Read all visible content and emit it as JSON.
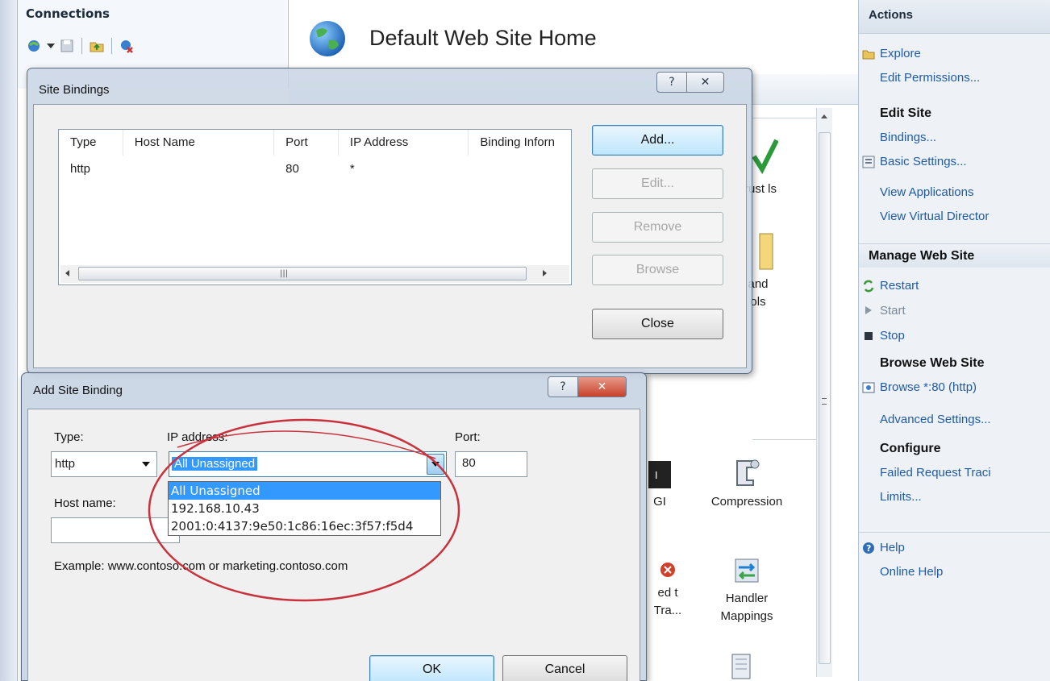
{
  "connections": {
    "title": "Connections"
  },
  "content": {
    "page_title": "Default Web Site Home",
    "features": [
      {
        "label": "rust ls"
      },
      {
        "label": "and ols"
      },
      {
        "label": "GI"
      },
      {
        "label": "Compression"
      },
      {
        "label": "ed t Tra..."
      },
      {
        "label": "Handler Mappings"
      }
    ]
  },
  "actions": {
    "title": "Actions",
    "explore": "Explore",
    "edit_permissions": "Edit Permissions...",
    "edit_site_head": "Edit Site",
    "bindings": "Bindings...",
    "basic_settings": "Basic Settings...",
    "view_applications": "View Applications",
    "view_virtual_directories": "View Virtual Director",
    "manage_head": "Manage Web Site",
    "restart": "Restart",
    "start": "Start",
    "stop": "Stop",
    "browse_head": "Browse Web Site",
    "browse_80": "Browse *:80 (http)",
    "advanced_settings": "Advanced Settings...",
    "configure_head": "Configure",
    "failed_request": "Failed Request Traci",
    "limits": "Limits...",
    "help": "Help",
    "online_help": "Online Help"
  },
  "site_bindings": {
    "title": "Site Bindings",
    "help_glyph": "?",
    "close_glyph": "✕",
    "columns": [
      "Type",
      "Host Name",
      "Port",
      "IP Address",
      "Binding Inforn"
    ],
    "rows": [
      {
        "type": "http",
        "host": "",
        "port": "80",
        "ip": "*",
        "info": ""
      }
    ],
    "buttons": {
      "add": "Add...",
      "edit": "Edit...",
      "remove": "Remove",
      "browse": "Browse",
      "close": "Close"
    }
  },
  "add_binding": {
    "title": "Add Site Binding",
    "type_label": "Type:",
    "type_value": "http",
    "ip_label": "IP address:",
    "ip_value": "All Unassigned",
    "port_label": "Port:",
    "port_value": "80",
    "host_label": "Host name:",
    "host_value": "",
    "example": "Example: www.contoso.com or marketing.contoso.com",
    "ip_options": [
      "All Unassigned",
      "192.168.10.43",
      "2001:0:4137:9e50:1c86:16ec:3f57:f5d4"
    ],
    "ok": "OK",
    "cancel": "Cancel"
  },
  "colors": {
    "link": "#1f5aa6",
    "selection": "#3399ff",
    "annotation": "#c8323c"
  }
}
